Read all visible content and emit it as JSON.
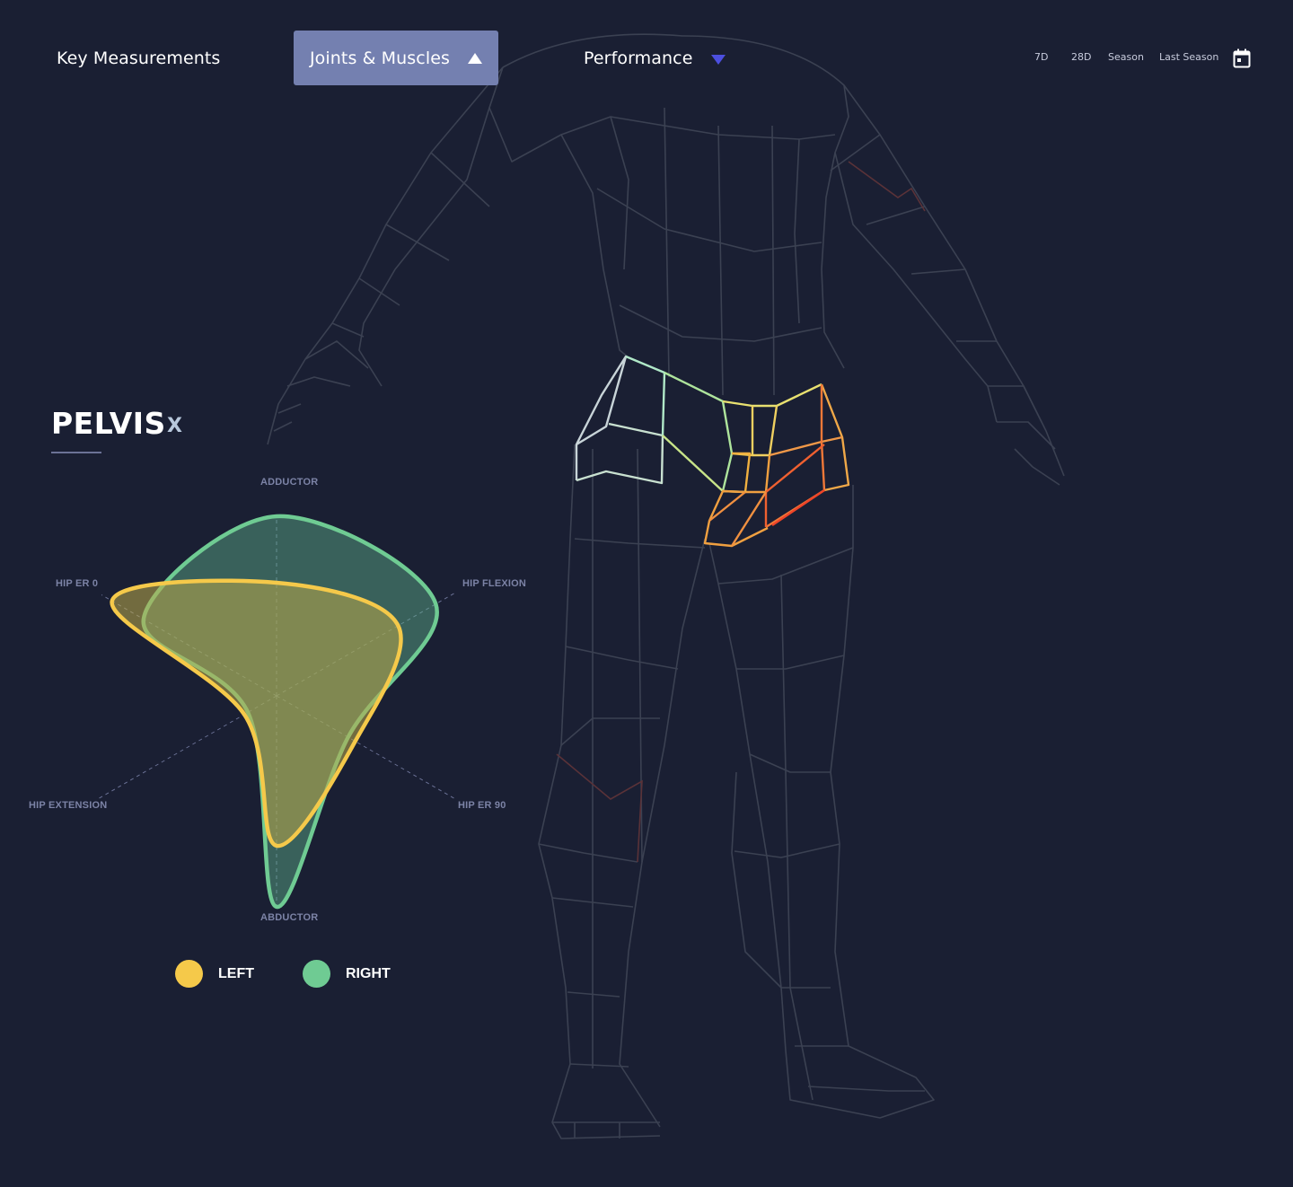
{
  "nav": {
    "tabs": [
      {
        "label": "Key Measurements"
      },
      {
        "label": "Joints & Muscles",
        "icon": "caret-up-icon"
      },
      {
        "label": "Performance",
        "icon": "caret-down-icon"
      }
    ],
    "date_ranges": [
      "7D",
      "28D",
      "Season",
      "Last Season"
    ],
    "calendar_icon": "calendar-icon"
  },
  "panel": {
    "title": "PELVIS",
    "close_label": "X"
  },
  "chart_data": {
    "type": "radar",
    "axes": [
      "ADDUCTOR",
      "HIP FLEXION",
      "HIP ER 90",
      "ABDUCTOR",
      "HIP EXTENSION",
      "HIP ER 0"
    ],
    "series": [
      {
        "name": "LEFT",
        "color": "#f5c94a",
        "values": [
          0.63,
          0.68,
          0.44,
          0.71,
          0.18,
          0.94
        ]
      },
      {
        "name": "RIGHT",
        "color": "#6fcb93",
        "values": [
          1.0,
          0.89,
          0.4,
          1.0,
          0.16,
          0.76
        ]
      }
    ],
    "ylim": [
      0,
      1
    ],
    "grid": false
  },
  "colors": {
    "background": "#1a1f33",
    "tab_active": "#7480b0",
    "accent_caret": "#4c4fe0",
    "left": "#f5c94a",
    "right": "#6fcb93",
    "axis_label": "#7c83a6",
    "wireframe": "#3b4152"
  }
}
